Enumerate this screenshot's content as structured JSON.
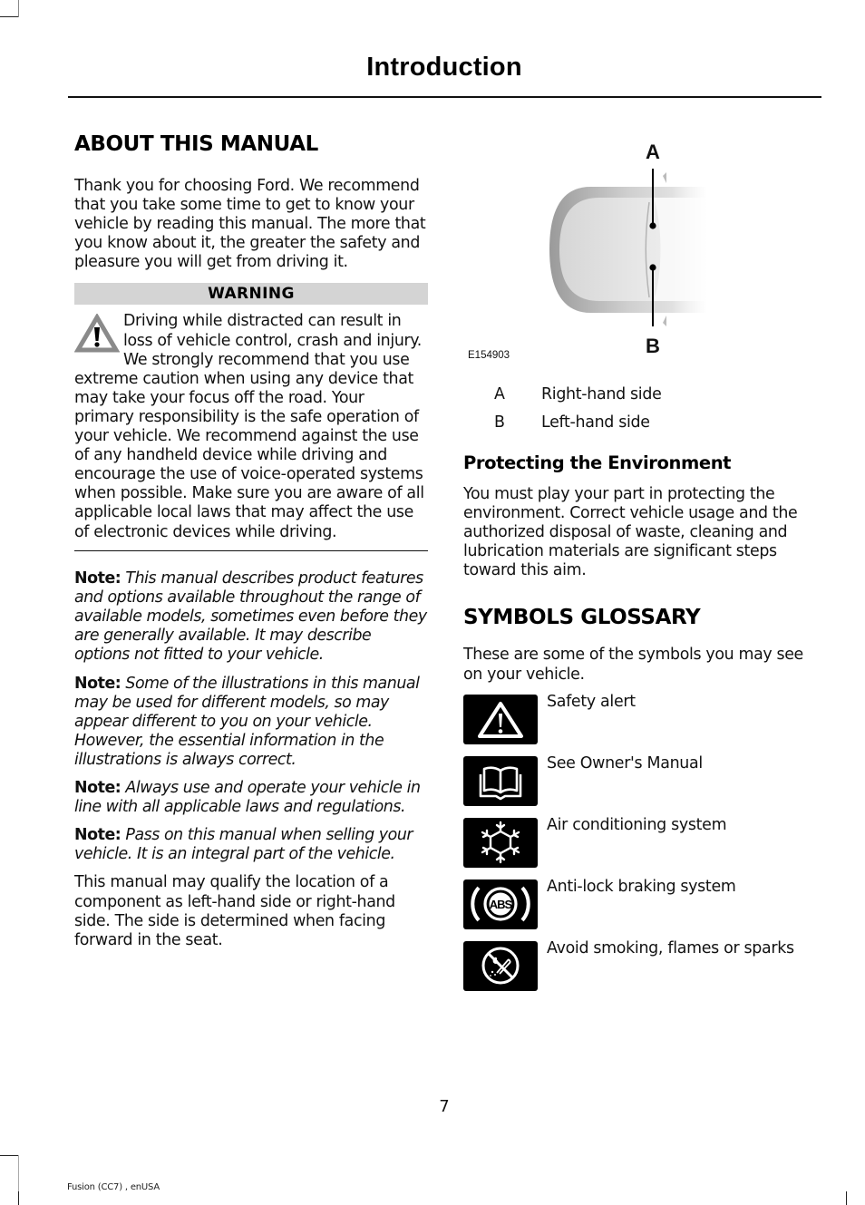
{
  "header": {
    "title": "Introduction"
  },
  "about": {
    "heading": "ABOUT THIS MANUAL",
    "intro": "Thank you for choosing Ford. We recommend that you take some time to get to know your vehicle by reading this manual. The more that you know about it, the greater the safety and pleasure you will get from driving it.",
    "warning": {
      "label": "WARNING",
      "icon": "warning-triangle-icon",
      "text": "Driving while distracted can result in loss of vehicle control, crash and injury. We strongly recommend that you use extreme caution when using any device that may take your focus off the road. Your primary responsibility is the safe operation of your vehicle. We recommend against the use of any handheld device while driving and encourage the use of voice-operated systems when possible. Make sure you are aware of all applicable local laws that may affect the use of electronic devices while driving."
    },
    "notes": [
      {
        "label": "Note:",
        "text": "This manual describes product features and options available throughout the range of available models, sometimes even before they are generally available. It may describe options not fitted to your vehicle."
      },
      {
        "label": "Note:",
        "text": "Some of the illustrations in this manual may be used for different models, so may appear different to you on your vehicle. However, the essential information in the illustrations is always correct."
      },
      {
        "label": "Note:",
        "text": "Always use and operate your vehicle in line with all applicable laws and regulations."
      },
      {
        "label": "Note:",
        "text": "Pass on this manual when selling your vehicle. It is an integral part of the vehicle."
      }
    ],
    "side_text": "This manual may qualify the location of a component as left-hand side or right-hand side. The side is determined when facing forward in the seat."
  },
  "figure": {
    "id": "E154903",
    "callout_a": "A",
    "callout_b": "B",
    "legend": [
      {
        "key": "A",
        "value": "Right-hand side"
      },
      {
        "key": "B",
        "value": "Left-hand side"
      }
    ]
  },
  "environment": {
    "heading": "Protecting the Environment",
    "text": "You must play your part in protecting the environment. Correct vehicle usage and the authorized disposal of waste, cleaning and lubrication materials are significant steps toward this aim."
  },
  "glossary": {
    "heading": "SYMBOLS GLOSSARY",
    "intro": "These are some of the symbols you may see on your vehicle.",
    "symbols": [
      {
        "icon": "safety-alert-icon",
        "label": "Safety alert"
      },
      {
        "icon": "owners-manual-icon",
        "label": "See Owner's Manual"
      },
      {
        "icon": "air-conditioning-icon",
        "label": "Air conditioning system"
      },
      {
        "icon": "abs-icon",
        "label": "Anti-lock braking system",
        "glyph_text": "ABS"
      },
      {
        "icon": "no-smoking-flames-icon",
        "label": "Avoid smoking, flames or sparks"
      }
    ]
  },
  "footer": {
    "page_number": "7",
    "doc_id": "Fusion (CC7) , enUSA"
  }
}
